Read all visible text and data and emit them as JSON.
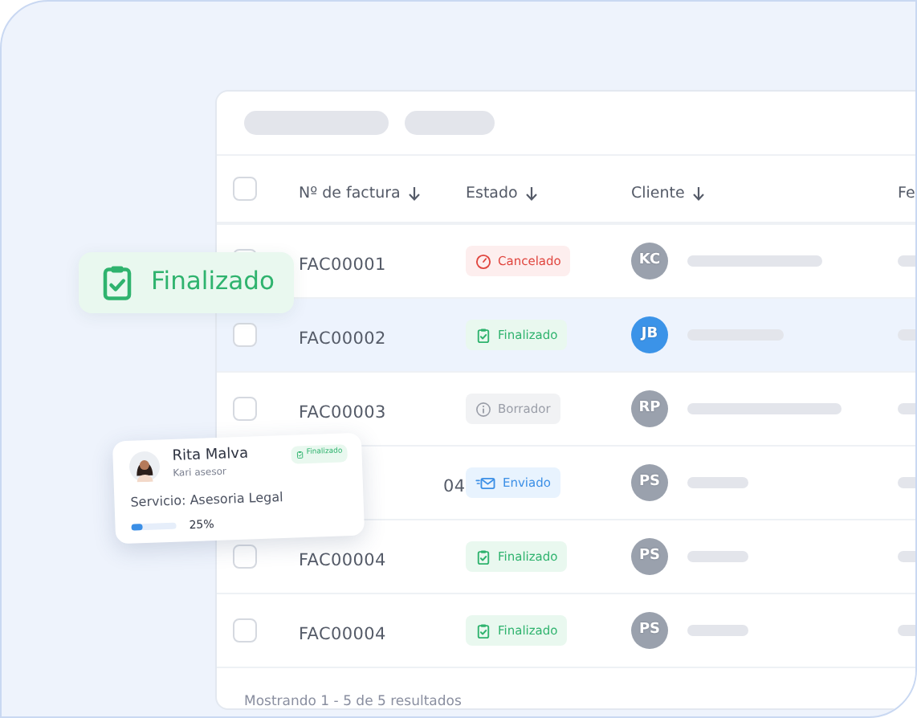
{
  "select_all": {
    "checked": false
  },
  "columns": [
    {
      "label": "Nº de factura",
      "sortable": true
    },
    {
      "label": "Estado",
      "sortable": true
    },
    {
      "label": "Cliente",
      "sortable": true
    },
    {
      "label": "Fe",
      "sortable": false
    }
  ],
  "rows": [
    {
      "invoice": "FAC00001",
      "status": {
        "kind": "cancelado",
        "label": "Cancelado"
      },
      "initials": "KC",
      "color": "#9aa1ad",
      "selected": false,
      "checked": false
    },
    {
      "invoice": "FAC00002",
      "status": {
        "kind": "finalizado",
        "label": "Finalizado"
      },
      "initials": "JB",
      "color": "#3b93e8",
      "selected": true,
      "checked": false
    },
    {
      "invoice": "FAC00003",
      "status": {
        "kind": "borrador",
        "label": "Borrador"
      },
      "initials": "RP",
      "color": "#9aa1ad",
      "selected": false,
      "checked": false
    },
    {
      "invoice": "04",
      "status": {
        "kind": "enviado",
        "label": "Enviado"
      },
      "initials": "PS",
      "color": "#9aa1ad",
      "selected": false
    },
    {
      "invoice": "FAC00004",
      "status": {
        "kind": "finalizado",
        "label": "Finalizado"
      },
      "initials": "PS",
      "color": "#9aa1ad",
      "selected": false,
      "checked": false
    },
    {
      "invoice": "FAC00004",
      "status": {
        "kind": "finalizado",
        "label": "Finalizado"
      },
      "initials": "PS",
      "color": "#9aa1ad",
      "selected": false,
      "checked": false
    }
  ],
  "footer": "Mostrando 1 - 5 de 5 resultados",
  "floating_badge": {
    "kind": "finalizado",
    "label": "Finalizado"
  },
  "service_card": {
    "name": "Rita Malva",
    "role": "Kari asesor",
    "status": {
      "kind": "finalizado",
      "label": "Finalizado"
    },
    "service": "Servicio: Asesoria Legal",
    "level": 0.25,
    "reading": "25%"
  }
}
